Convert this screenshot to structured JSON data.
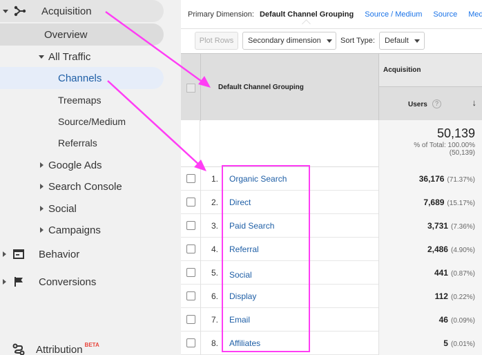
{
  "sidebar": {
    "acquisition": "Acquisition",
    "overview": "Overview",
    "all_traffic": "All Traffic",
    "channels": "Channels",
    "treemaps": "Treemaps",
    "source_medium": "Source/Medium",
    "referrals": "Referrals",
    "google_ads": "Google Ads",
    "search_console": "Search Console",
    "social": "Social",
    "campaigns": "Campaigns",
    "behavior": "Behavior",
    "conversions": "Conversions",
    "attribution": "Attribution",
    "beta": "BETA"
  },
  "topbar": {
    "primary_dimension_label": "Primary Dimension:",
    "active": "Default Channel Grouping",
    "links": [
      "Source / Medium",
      "Source",
      "Medium"
    ]
  },
  "toolbar": {
    "plot_rows": "Plot Rows",
    "secondary_dimension": "Secondary dimension",
    "sort_type_label": "Sort Type:",
    "sort_type_value": "Default"
  },
  "table": {
    "dimension_header": "Default Channel Grouping",
    "group_header": "Acquisition",
    "metric_header": "Users",
    "help_glyph": "?",
    "sort_glyph": "↓",
    "total": {
      "value": "50,139",
      "pct": "% of Total: 100.00%",
      "abs": "(50,139)"
    },
    "rows": [
      {
        "index": "1.",
        "name": "Organic Search",
        "value": "36,176",
        "pct": "(71.37%)"
      },
      {
        "index": "2.",
        "name": "Direct",
        "value": "7,689",
        "pct": "(15.17%)"
      },
      {
        "index": "3.",
        "name": "Paid Search",
        "value": "3,731",
        "pct": "(7.36%)"
      },
      {
        "index": "4.",
        "name": "Referral",
        "value": "2,486",
        "pct": "(4.90%)"
      },
      {
        "index": "5.",
        "name": "Social",
        "value": "441",
        "pct": "(0.87%)"
      },
      {
        "index": "6.",
        "name": "Display",
        "value": "112",
        "pct": "(0.22%)"
      },
      {
        "index": "7.",
        "name": "Email",
        "value": "46",
        "pct": "(0.09%)"
      },
      {
        "index": "8.",
        "name": "Affiliates",
        "value": "5",
        "pct": "(0.01%)"
      }
    ]
  },
  "colors": {
    "annotation": "#ff3df5",
    "link": "#1f5fa6",
    "sidebar_selected": "#e6edf9"
  },
  "icons": [
    "acquisition-icon",
    "behavior-icon",
    "conversions-icon",
    "attribution-icon",
    "help-icon",
    "arrow-down-icon"
  ]
}
